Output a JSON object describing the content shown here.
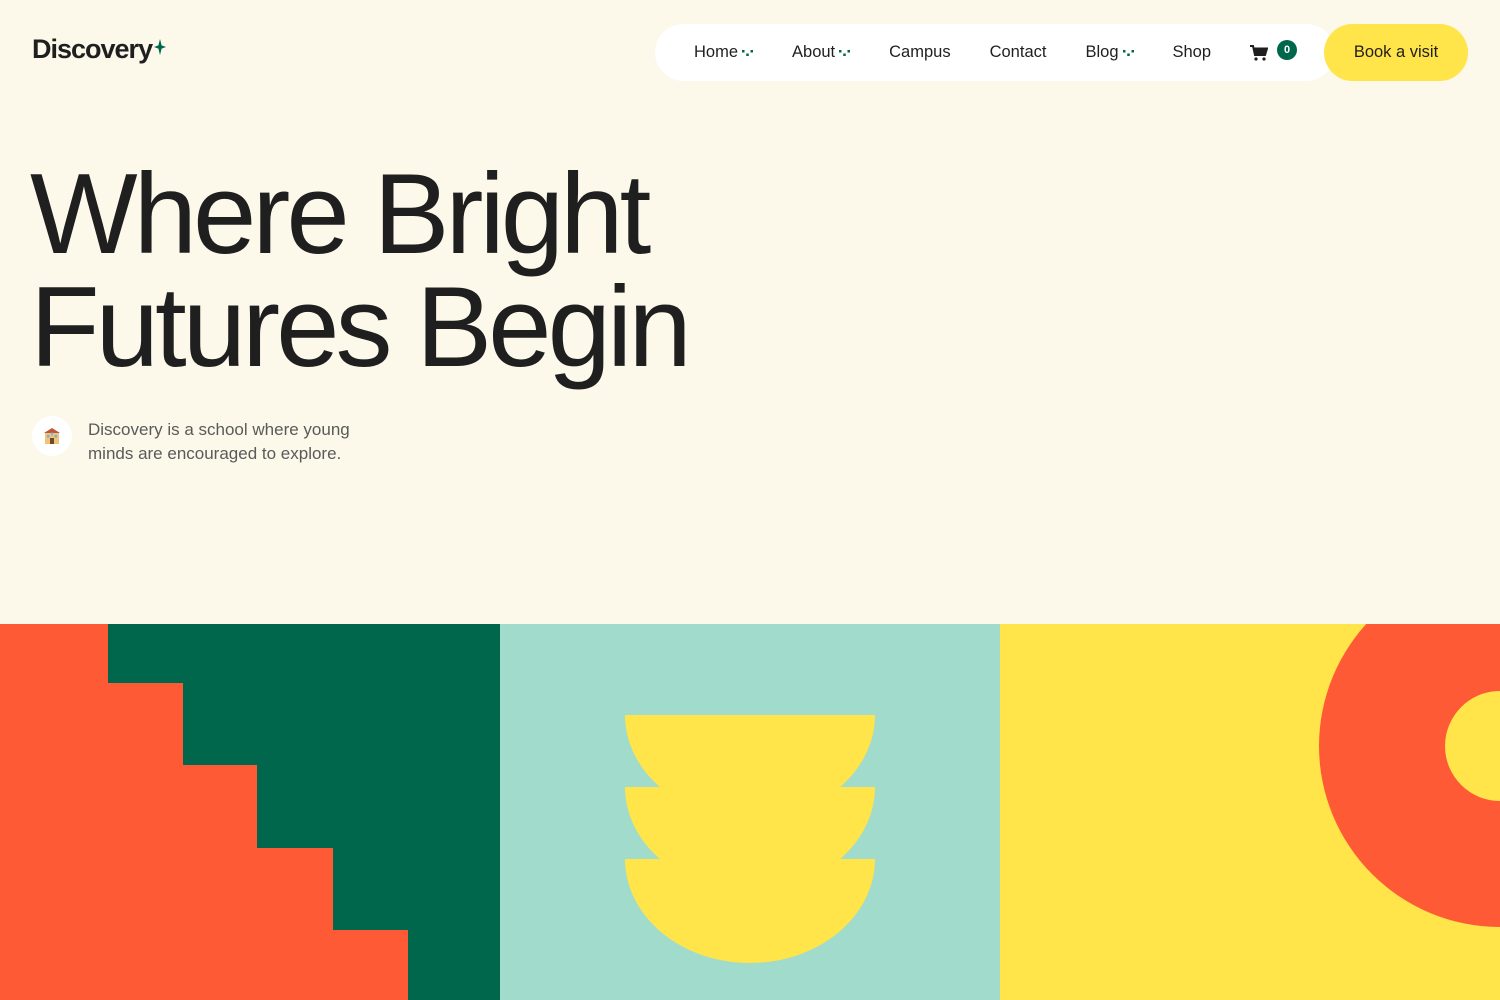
{
  "brand": {
    "name": "Discovery"
  },
  "nav": {
    "items": [
      {
        "label": "Home",
        "has_dropdown": true
      },
      {
        "label": "About",
        "has_dropdown": true
      },
      {
        "label": "Campus",
        "has_dropdown": false
      },
      {
        "label": "Contact",
        "has_dropdown": false
      },
      {
        "label": "Blog",
        "has_dropdown": true
      },
      {
        "label": "Shop",
        "has_dropdown": false
      }
    ],
    "cart_count": "0"
  },
  "cta": {
    "label": "Book a visit"
  },
  "hero": {
    "title_line1": "Where Bright",
    "title_line2": "Futures Begin",
    "intro_icon": "school-building-icon",
    "intro_text": "Discovery is a school where young minds are encouraged to explore."
  },
  "colors": {
    "background": "#fcf8ea",
    "accent_green": "#00674d",
    "accent_yellow": "#ffe44a",
    "accent_orange": "#ff5a36",
    "accent_mint": "#a0dbcc"
  }
}
